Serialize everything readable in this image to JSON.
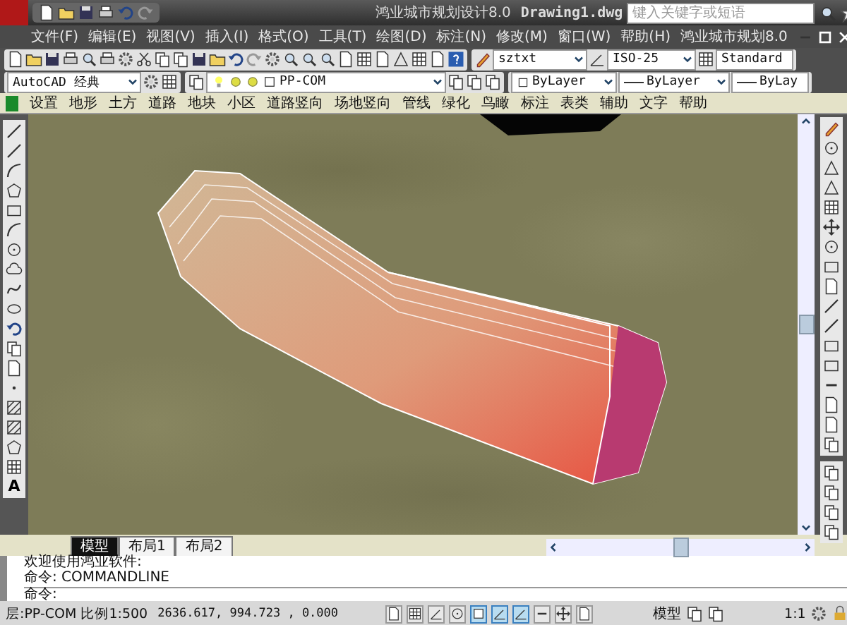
{
  "title_bar": {
    "app_title": "鸿业城市规划设计8.0",
    "document": "Drawing1.dwg",
    "search": {
      "placeholder": "键入关键字或短语"
    }
  },
  "menu_bar": {
    "items": [
      "文件(F)",
      "编辑(E)",
      "视图(V)",
      "插入(I)",
      "格式(O)",
      "工具(T)",
      "绘图(D)",
      "标注(N)",
      "修改(M)",
      "窗口(W)",
      "帮助(H)",
      "鸿业城市规划8.0"
    ]
  },
  "toolbars": {
    "text_style": "sztxt",
    "dim_style": "ISO-25",
    "table_style": "Standard",
    "workspace": "AutoCAD 经典",
    "layer": "PP-COM",
    "color_control": "ByLayer",
    "linetype": "ByLayer",
    "lineweight": "ByLay"
  },
  "custom_menu": {
    "items": [
      "设置",
      "地形",
      "土方",
      "道路",
      "地块",
      "小区",
      "道路竖向",
      "场地竖向",
      "管线",
      "绿化",
      "鸟瞰",
      "标注",
      "表类",
      "辅助",
      "文字",
      "帮助"
    ]
  },
  "draw_toolbar": {
    "text_tool": "A"
  },
  "layout_tabs": [
    {
      "label": "模型",
      "selected": true
    },
    {
      "label": "布局1",
      "selected": false
    },
    {
      "label": "布局2",
      "selected": false
    }
  ],
  "command_window": {
    "history": [
      "欢迎使用鸿业软件:",
      "命令: COMMANDLINE"
    ],
    "prompt": "命令:"
  },
  "status_bar": {
    "layer_info": "层:PP-COM 比例1:500",
    "coordinates": "2636.617, 994.723 , 0.000",
    "toggles": [
      {
        "on": false
      },
      {
        "on": false
      },
      {
        "on": false
      },
      {
        "on": false
      },
      {
        "on": true
      },
      {
        "on": true
      },
      {
        "on": true
      },
      {
        "on": false
      },
      {
        "on": false
      },
      {
        "on": false
      }
    ],
    "model": "模型",
    "annotation_scale": "1:1"
  }
}
